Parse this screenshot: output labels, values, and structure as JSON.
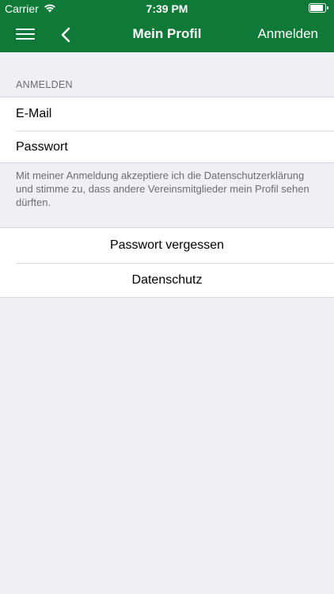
{
  "status_bar": {
    "carrier": "Carrier",
    "time": "7:39 PM",
    "battery_level": 0.95
  },
  "nav_bar": {
    "title": "Mein Profil",
    "action_label": "Anmelden",
    "background_color": "#0f7a37",
    "icons": [
      "menu-icon",
      "back-icon"
    ]
  },
  "login_section": {
    "header": "ANMELDEN",
    "email_placeholder": "E-Mail",
    "password_placeholder": "Passwort",
    "consent_text": "Mit meiner Anmeldung akzeptiere ich die Datenschutzerklärung und stimme zu, dass andere Vereinsmitglieder mein Profil sehen dürften."
  },
  "links_section": {
    "forgot_password_label": "Passwort vergessen",
    "privacy_label": "Datenschutz"
  }
}
